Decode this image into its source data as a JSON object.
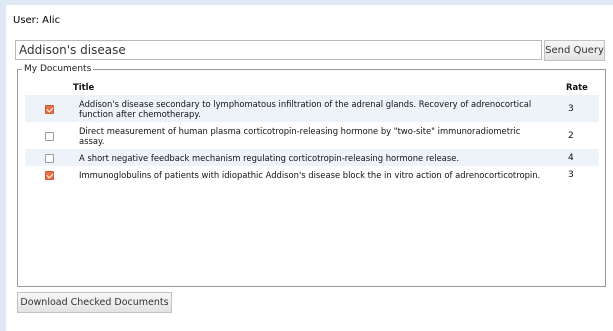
{
  "user": {
    "label": "User: Alic"
  },
  "query": {
    "value": "Addison's disease",
    "button": "Send Query"
  },
  "documents": {
    "legend": "My Documents",
    "columns": {
      "title": "Title",
      "rate": "Rate"
    },
    "rows": [
      {
        "checked": true,
        "title": "Addison's disease secondary to lymphomatous infiltration of the adrenal glands. Recovery of adrenocortical function after chemotherapy.",
        "rate": "3"
      },
      {
        "checked": false,
        "title": "Direct measurement of human plasma corticotropin-releasing hormone by \"two-site\" immunoradiometric assay.",
        "rate": "2"
      },
      {
        "checked": false,
        "title": "A short negative feedback mechanism regulating corticotropin-releasing hormone release.",
        "rate": "4"
      },
      {
        "checked": true,
        "title": "Immunoglobulins of patients with idiopathic Addison's disease block the in vitro action of adrenocorticotropin.",
        "rate": "3"
      }
    ]
  },
  "download": {
    "button": "Download Checked Documents"
  },
  "colors": {
    "checkbox_checked": "#e8734a",
    "row_alt": "#eef3fa",
    "page_bg": "#dfe9f4"
  }
}
